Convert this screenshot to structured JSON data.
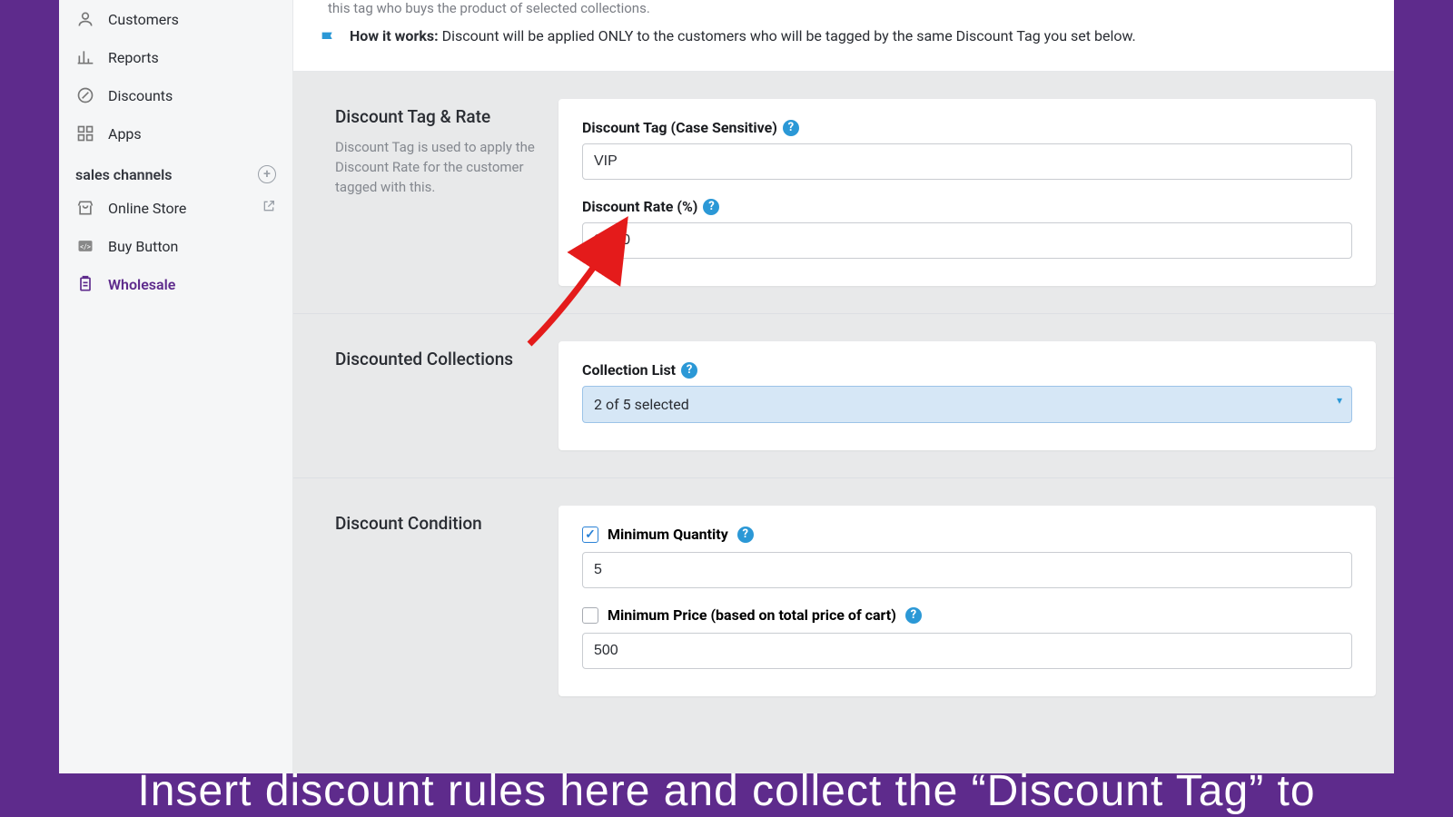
{
  "sidebar": {
    "nav": [
      {
        "label": "Customers"
      },
      {
        "label": "Reports"
      },
      {
        "label": "Discounts"
      },
      {
        "label": "Apps"
      }
    ],
    "sales_label": "sales channels",
    "channels": [
      {
        "label": "Online Store"
      },
      {
        "label": "Buy Button"
      },
      {
        "label": "Wholesale"
      }
    ]
  },
  "banner": {
    "partial_line": "this tag who buys the product of selected collections.",
    "how_label": "How it works:",
    "how_text": "Discount will be applied ONLY to the customers who will be tagged by the same Discount Tag you set below."
  },
  "block1": {
    "title": "Discount Tag & Rate",
    "desc": "Discount Tag is used to apply the Discount Rate for the customer tagged with this.",
    "tag_label": "Discount Tag (Case Sensitive)",
    "tag_value": "VIP",
    "rate_label": "Discount Rate (%)",
    "rate_value": "20.00"
  },
  "block2": {
    "title": "Discounted Collections",
    "list_label": "Collection List",
    "selected_text": "2 of 5 selected"
  },
  "block3": {
    "title": "Discount Condition",
    "min_qty_label": "Minimum Quantity",
    "min_qty_value": "5",
    "min_price_label": "Minimum Price (based on total price of cart)",
    "min_price_value": "500"
  },
  "caption": "Insert discount rules here and collect the “Discount Tag” to"
}
